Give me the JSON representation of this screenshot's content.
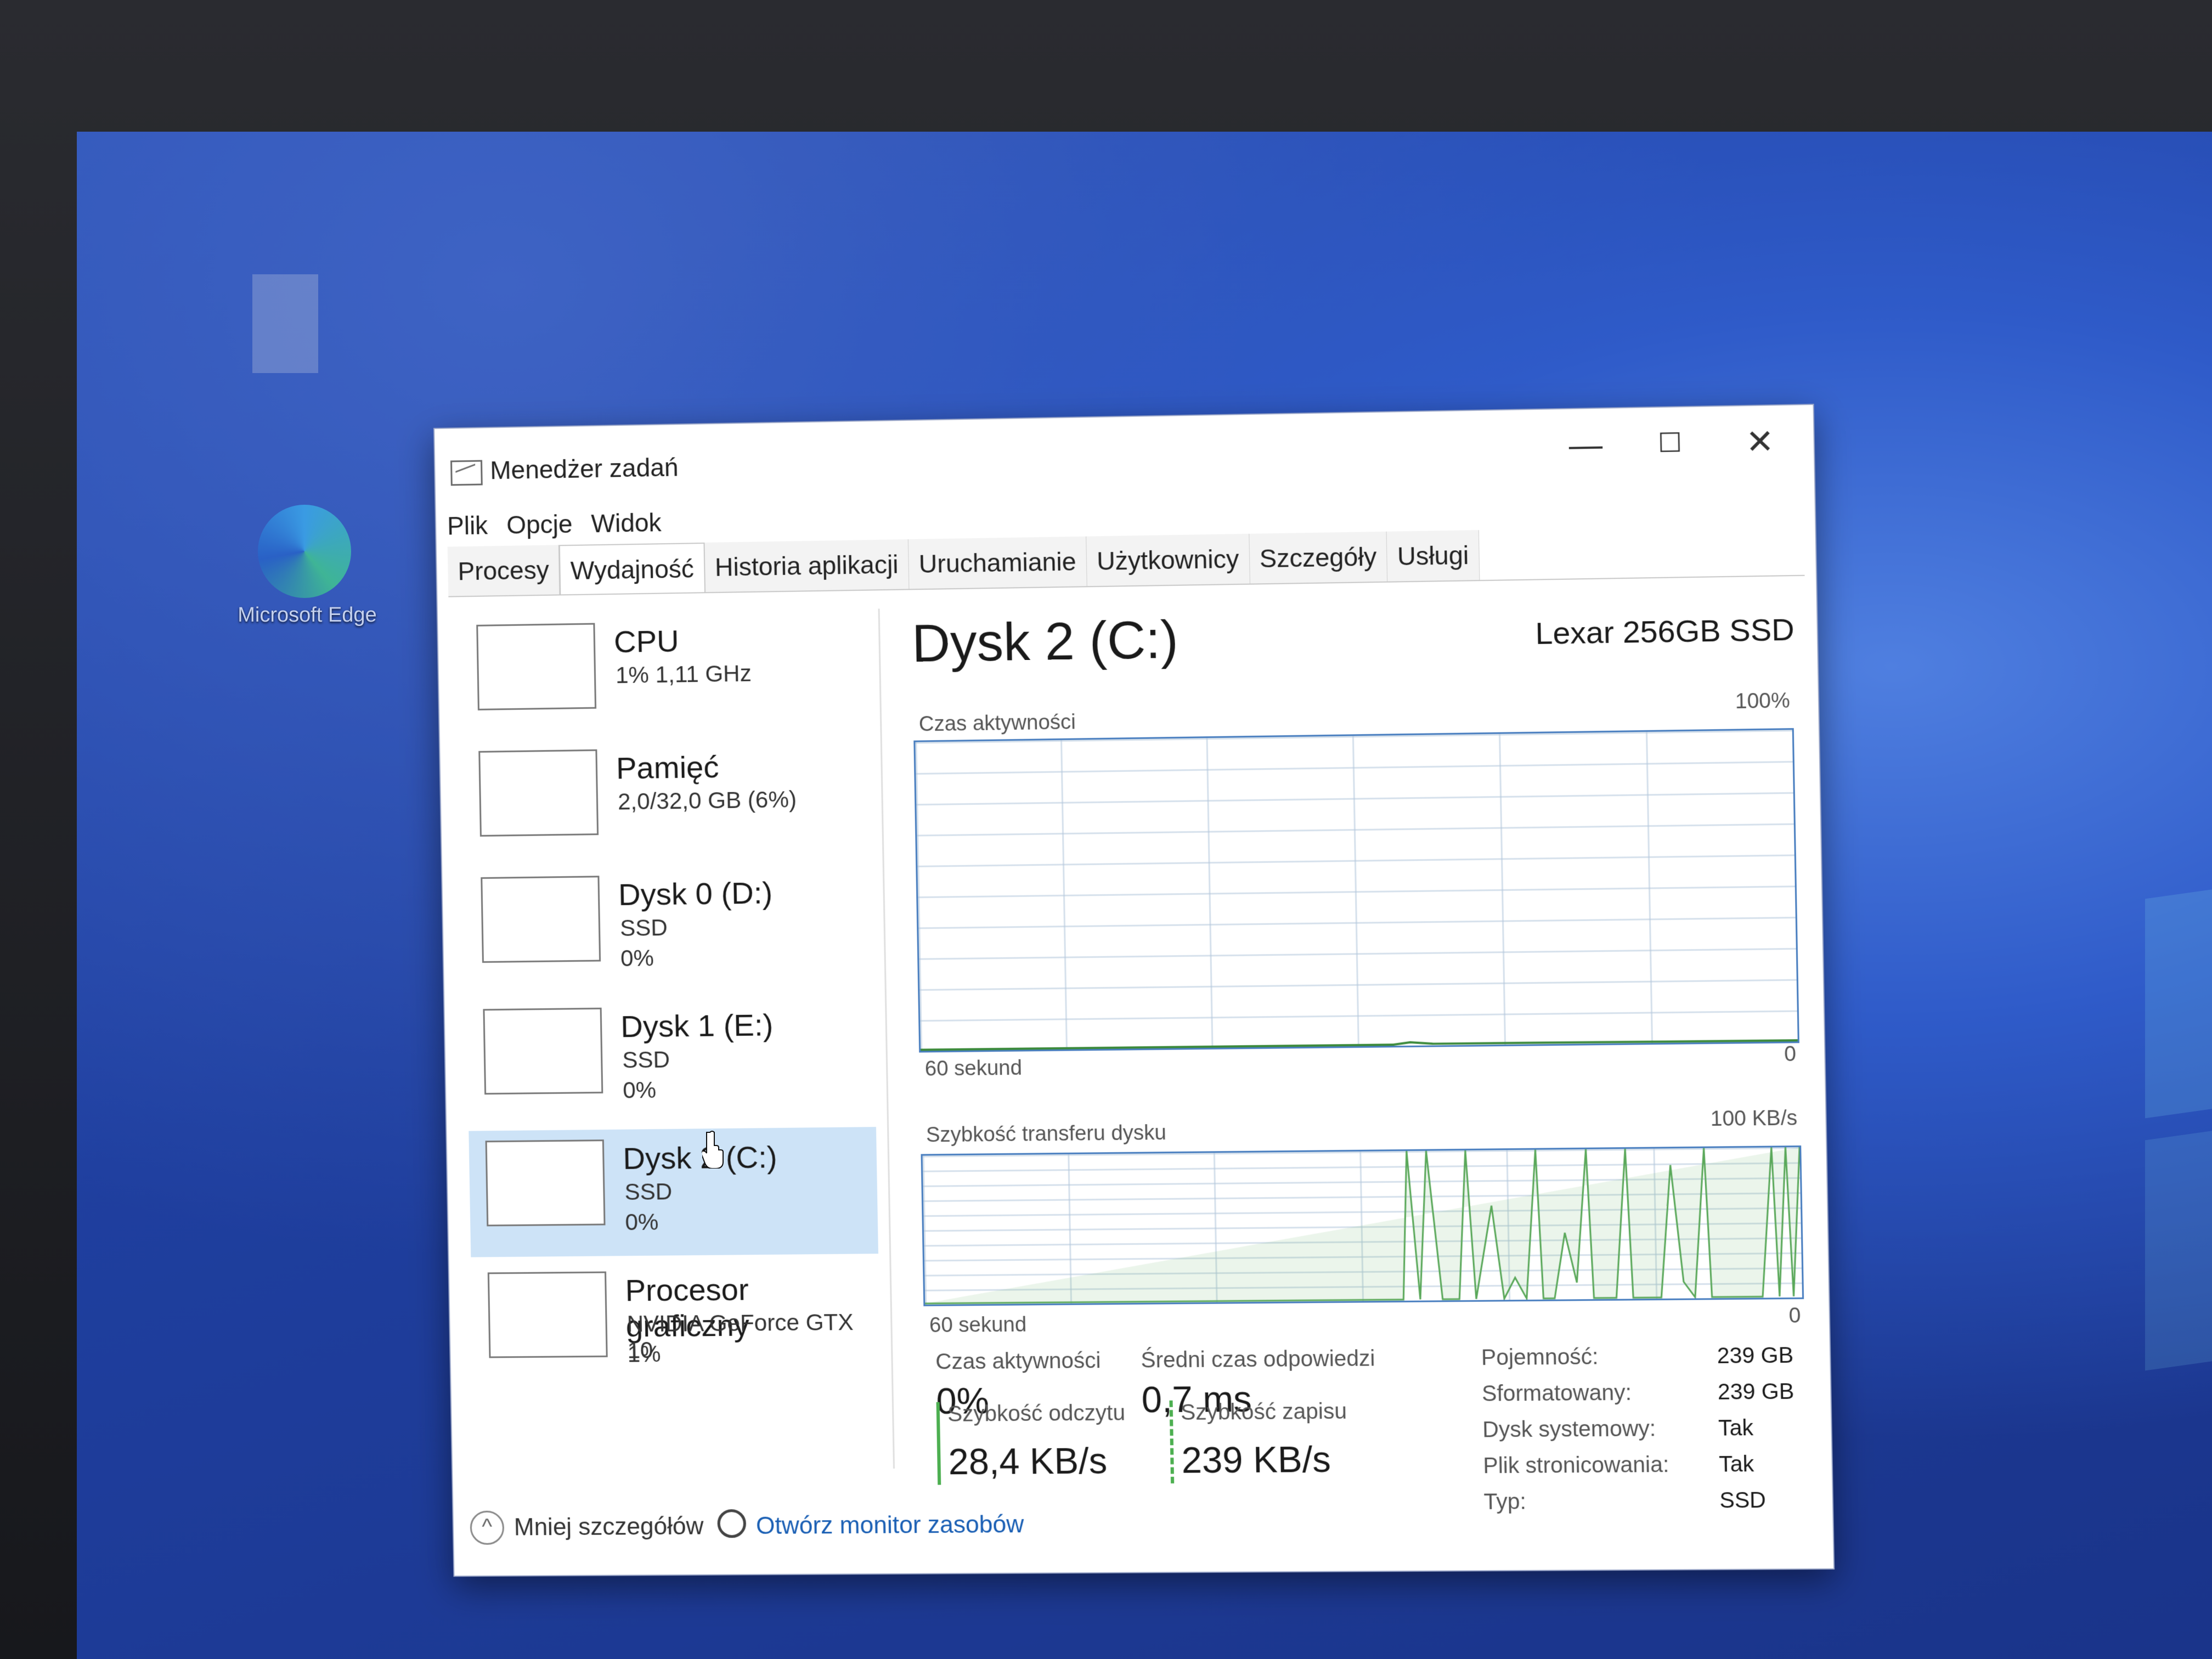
{
  "desktop": {
    "edge_label": "Microsoft Edge"
  },
  "window": {
    "title": "Menedżer zadań",
    "min": "—",
    "max": "☐",
    "close": "✕"
  },
  "menu": [
    "Plik",
    "Opcje",
    "Widok"
  ],
  "tabs": [
    "Procesy",
    "Wydajność",
    "Historia aplikacji",
    "Uruchamianie",
    "Użytkownicy",
    "Szczegóły",
    "Usługi"
  ],
  "active_tab": "Wydajność",
  "devices": [
    {
      "name": "CPU",
      "sub1": "1% 1,11 GHz",
      "sub2": ""
    },
    {
      "name": "Pamięć",
      "sub1": "2,0/32,0 GB (6%)",
      "sub2": ""
    },
    {
      "name": "Dysk 0 (D:)",
      "sub1": "SSD",
      "sub2": "0%"
    },
    {
      "name": "Dysk 1 (E:)",
      "sub1": "SSD",
      "sub2": "0%"
    },
    {
      "name": "Dysk 2 (C:)",
      "sub1": "SSD",
      "sub2": "0%"
    },
    {
      "name": "Procesor graficzny",
      "sub1": "NVIDIA GeForce GTX 10",
      "sub2": "1%"
    }
  ],
  "selected_device": "Dysk 2 (C:)",
  "detail": {
    "title": "Dysk 2 (C:)",
    "model": "Lexar 256GB SSD",
    "graph1": {
      "label": "Czas aktywności",
      "max": "100%",
      "min": "0",
      "time": "60 sekund"
    },
    "graph2": {
      "label": "Szybkość transferu dysku",
      "max": "100 KB/s",
      "min": "0",
      "time": "60 sekund"
    },
    "stats": {
      "active_label": "Czas aktywności",
      "active_value": "0%",
      "response_label": "Średni czas odpowiedzi",
      "response_value": "0,7 ms",
      "read_label": "Szybkość odczytu",
      "read_value": "28,4 KB/s",
      "write_label": "Szybkość zapisu",
      "write_value": "239 KB/s"
    },
    "props": [
      {
        "k": "Pojemność:",
        "v": "239 GB"
      },
      {
        "k": "Sformatowany:",
        "v": "239 GB"
      },
      {
        "k": "Dysk systemowy:",
        "v": "Tak"
      },
      {
        "k": "Plik stronicowania:",
        "v": "Tak"
      },
      {
        "k": "Typ:",
        "v": "SSD"
      }
    ]
  },
  "footer": {
    "less": "Mniej szczegółów",
    "monitor": "Otwórz monitor zasobów"
  }
}
